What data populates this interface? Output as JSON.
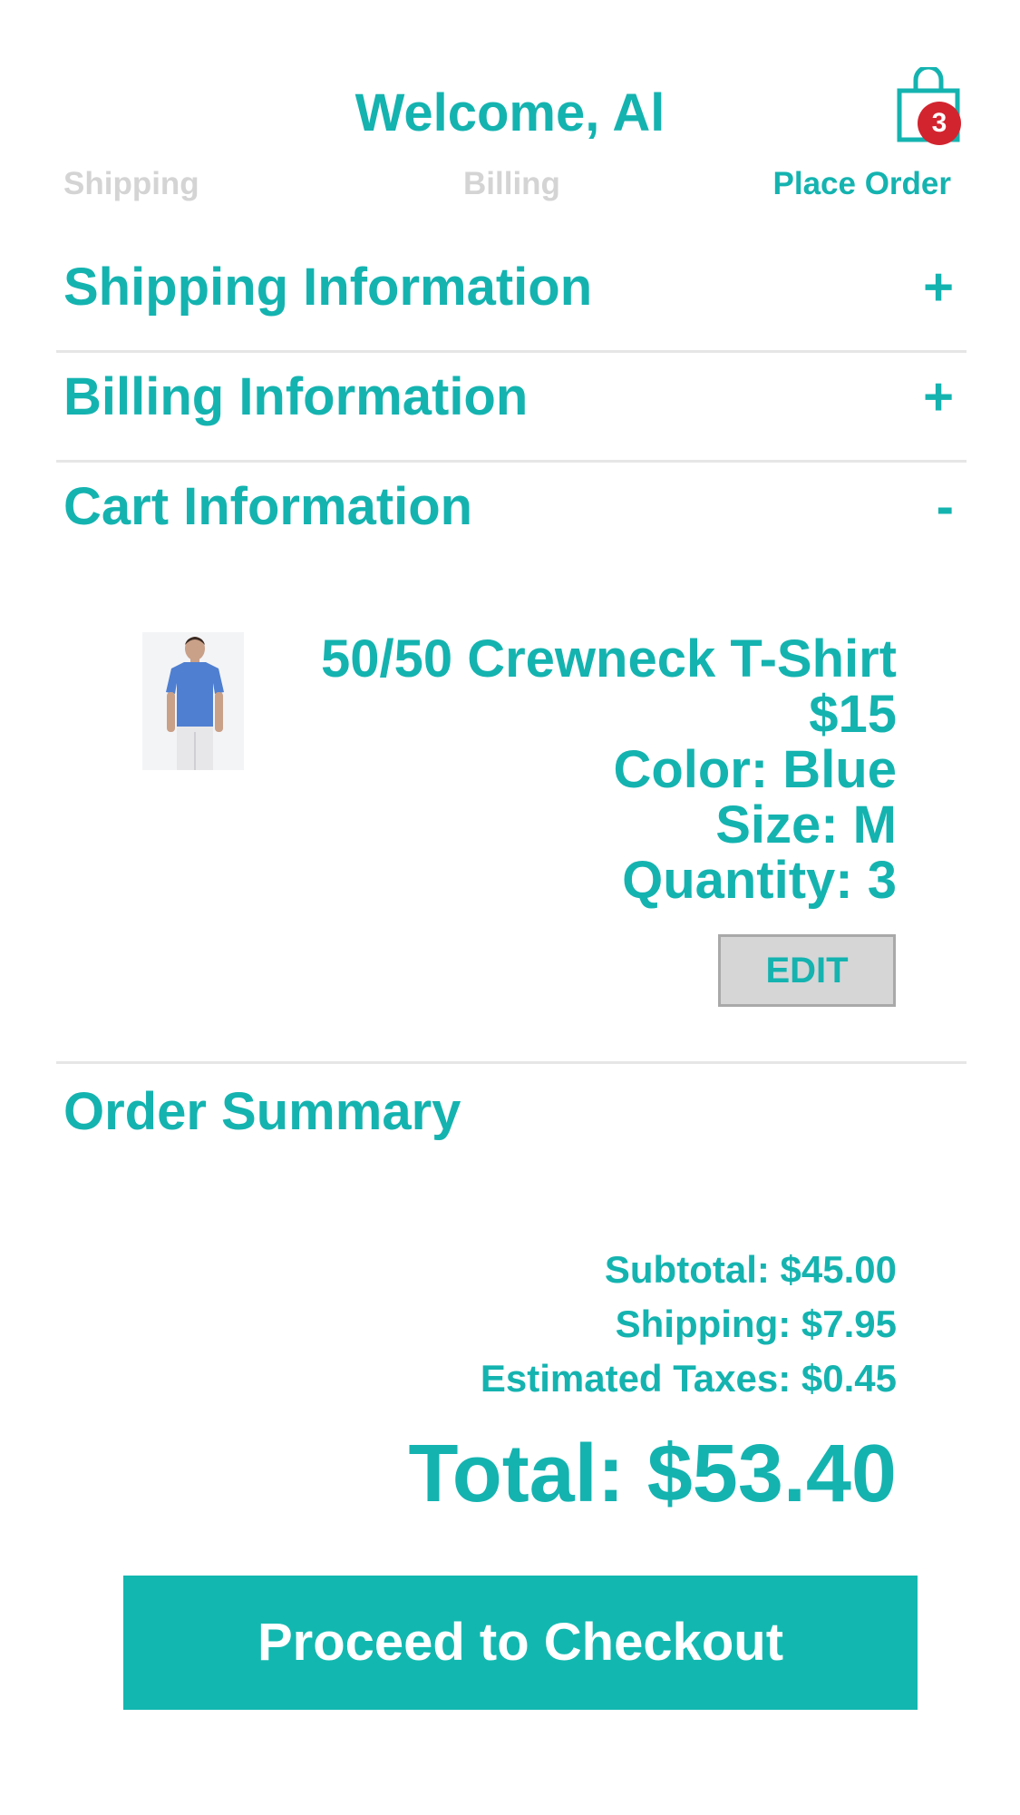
{
  "header": {
    "title": "Welcome, Al",
    "cart_count": "3"
  },
  "steps": [
    {
      "label": "Shipping",
      "state": "inactive"
    },
    {
      "label": "Billing",
      "state": "inactive"
    },
    {
      "label": "Place Order",
      "state": "active"
    }
  ],
  "sections": {
    "shipping": {
      "title": "Shipping Information",
      "toggle": "+"
    },
    "billing": {
      "title": "Billing Information",
      "toggle": "+"
    },
    "cart": {
      "title": "Cart Information",
      "toggle": "-"
    }
  },
  "cart_item": {
    "name": "50/50 Crewneck T-Shirt",
    "price": "$15",
    "color": "Color: Blue",
    "size": "Size: M",
    "quantity": "Quantity: 3",
    "edit_label": "EDIT",
    "image": "blue-tshirt-model"
  },
  "summary": {
    "title": "Order Summary",
    "subtotal": "Subtotal: $45.00",
    "shipping": "Shipping: $7.95",
    "taxes": "Estimated Taxes: $0.45",
    "total": "Total: $53.40"
  },
  "checkout_label": "Proceed to Checkout",
  "colors": {
    "accent": "#14b3b0",
    "button": "#12b8b0",
    "badge": "#d2242f",
    "inactive": "#d4d4d4",
    "divider": "#e6e6e6"
  }
}
